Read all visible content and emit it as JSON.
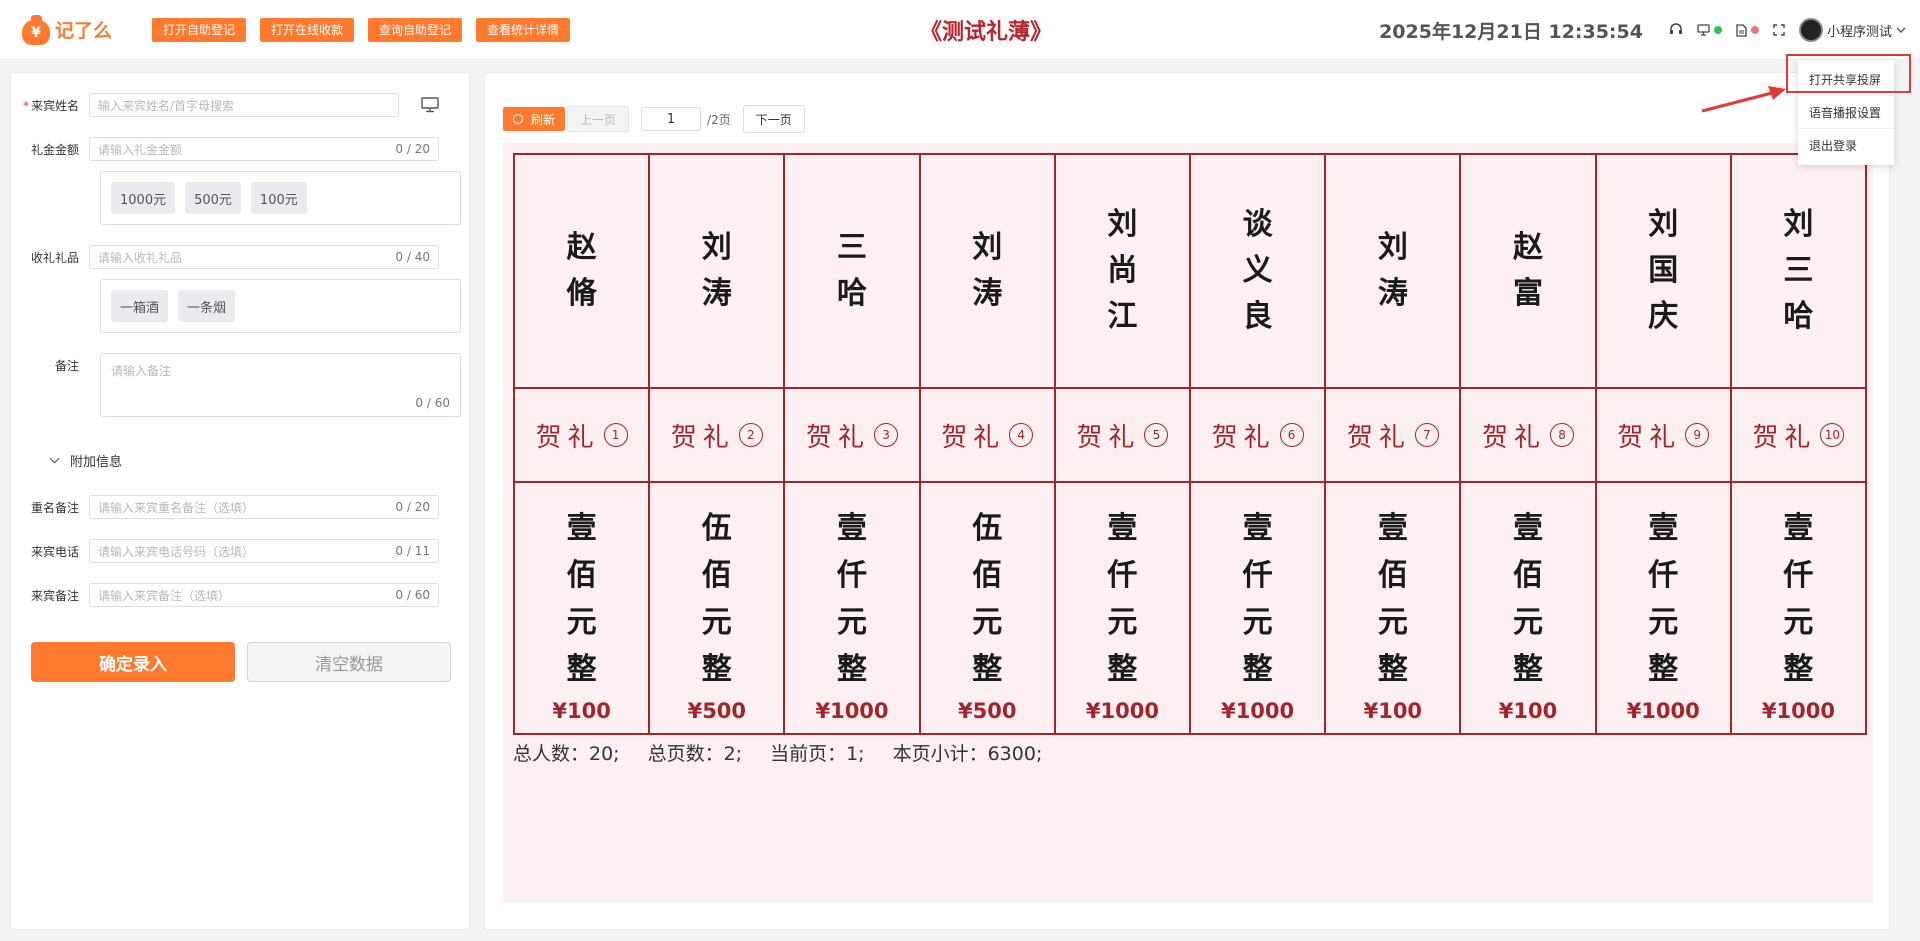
{
  "header": {
    "logo_mark": "¥",
    "logo_text": "记了么",
    "buttons": [
      "打开自助登记",
      "打开在线收款",
      "查询自助登记",
      "查看统计详情"
    ],
    "title": "《测试礼薄》",
    "datetime": "2025年12月21日 12:35:54",
    "status_colors": {
      "green": "#33c25a",
      "red": "#f2777a"
    },
    "username": "小程序测试"
  },
  "dropdown": {
    "items": [
      "打开共享投屏",
      "语音播报设置",
      "退出登录"
    ]
  },
  "form": {
    "name": {
      "label": "来宾姓名",
      "placeholder": "输入来宾姓名/首字母搜索"
    },
    "amount": {
      "label": "礼金金额",
      "placeholder": "请输入礼金金额",
      "count": "0 / 20",
      "chips": [
        "1000元",
        "500元",
        "100元"
      ]
    },
    "gift": {
      "label": "收礼礼品",
      "placeholder": "请输入收礼礼品",
      "count": "0 / 40",
      "chips": [
        "一箱酒",
        "一条烟"
      ]
    },
    "note": {
      "label": "备注",
      "placeholder": "请输入备注",
      "count": "0 / 60"
    },
    "extra_label": "附加信息",
    "dup_note": {
      "label": "重名备注",
      "placeholder": "请输入来宾重名备注（选填）",
      "count": "0 / 20"
    },
    "phone": {
      "label": "来宾电话",
      "placeholder": "请输入来宾电话号码（选填）",
      "count": "0 / 11"
    },
    "guest_note": {
      "label": "来宾备注",
      "placeholder": "请输入来宾备注（选填）",
      "count": "0 / 60"
    },
    "submit_label": "确定录入",
    "clear_label": "清空数据"
  },
  "toolbar": {
    "refresh_label": "刷新",
    "prev_label": "上一页",
    "page_value": "1",
    "page_total": "/2页",
    "next_label": "下一页"
  },
  "book": {
    "gift_label": "贺礼",
    "entries": [
      {
        "name": "赵脩",
        "amount_text": "壹佰元整",
        "index": "1",
        "money": "¥100"
      },
      {
        "name": "刘涛",
        "amount_text": "伍佰元整",
        "index": "2",
        "money": "¥500"
      },
      {
        "name": "三哈",
        "amount_text": "壹仟元整",
        "index": "3",
        "money": "¥1000"
      },
      {
        "name": "刘涛",
        "amount_text": "伍佰元整",
        "index": "4",
        "money": "¥500"
      },
      {
        "name": "刘尚江",
        "amount_text": "壹仟元整",
        "index": "5",
        "money": "¥1000"
      },
      {
        "name": "谈义良",
        "amount_text": "壹仟元整",
        "index": "6",
        "money": "¥1000"
      },
      {
        "name": "刘涛",
        "amount_text": "壹佰元整",
        "index": "7",
        "money": "¥100"
      },
      {
        "name": "赵富",
        "amount_text": "壹佰元整",
        "index": "8",
        "money": "¥100"
      },
      {
        "name": "刘国庆",
        "amount_text": "壹仟元整",
        "index": "9",
        "money": "¥1000"
      },
      {
        "name": "刘三哈",
        "amount_text": "壹仟元整",
        "index": "10",
        "money": "¥1000"
      }
    ],
    "summary": {
      "total_people": "总人数：20;",
      "total_pages": "总页数：2;",
      "current_page": "当前页：1;",
      "page_subtotal": "本页小计：6300;"
    }
  }
}
